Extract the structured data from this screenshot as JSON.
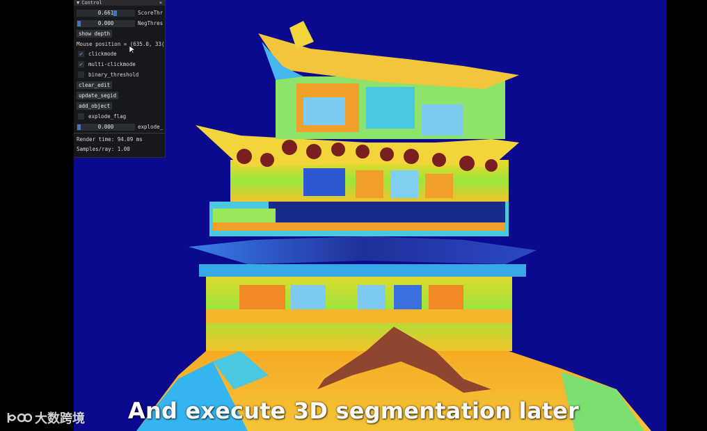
{
  "panel": {
    "title": "Control",
    "close": "×",
    "score_slider": {
      "value": "0.661",
      "label": "ScoreThr",
      "fill": 0.661
    },
    "neg_slider": {
      "value": "0.000",
      "label": "NegThres",
      "fill": 0.0
    },
    "show_depth_label": "show depth",
    "mouse_position": "Mouse position = (635.0, 33(",
    "clickmode": {
      "label": "clickmode",
      "checked": true
    },
    "multi_clickmode": {
      "label": "multi-clickmode",
      "checked": true
    },
    "binary_threshold": {
      "label": "binary_threshold",
      "checked": false
    },
    "clear_edit_label": "clear_edit",
    "update_segid_label": "update_segid",
    "add_object_label": "add_object",
    "explode_flag": {
      "label": "explode_flag",
      "checked": false
    },
    "explode_slider": {
      "value": "0.000",
      "label": "explode_",
      "fill": 0.0
    },
    "render_time": "Render time: 94.09 ms",
    "samples_ray": "Samples/ray: 1.00"
  },
  "caption": "And execute 3D segmentation later",
  "watermark": "大数跨境",
  "colors": {
    "background": "#0b0a8e",
    "panel_bg": "#17181b",
    "slider_grab": "#3a78c8",
    "check": "#4a8ad8"
  }
}
